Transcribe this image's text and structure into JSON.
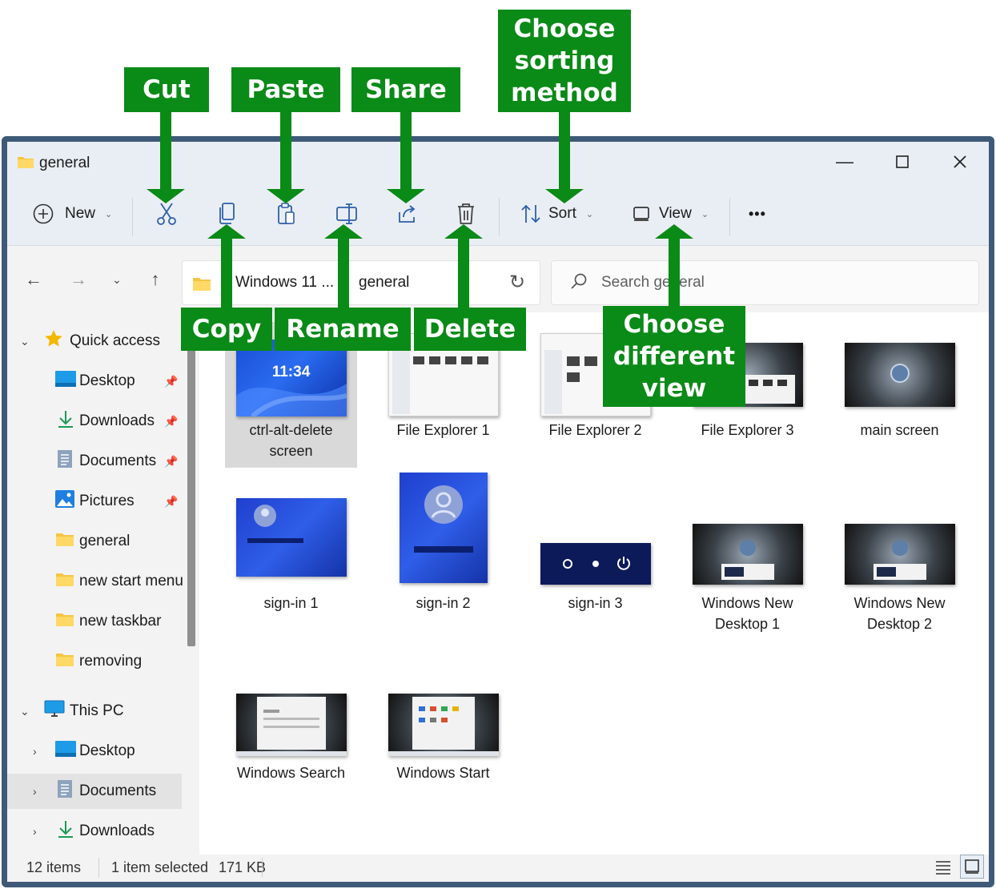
{
  "window": {
    "title": "general",
    "controls": {
      "minimize": "—",
      "maximize": "☐",
      "close": "✕"
    }
  },
  "toolbar": {
    "new_label": "New",
    "sort_label": "Sort",
    "view_label": "View",
    "more_label": "•••",
    "icons": [
      "cut-icon",
      "copy-icon",
      "paste-icon",
      "rename-icon",
      "share-icon",
      "delete-icon"
    ]
  },
  "address": {
    "segment1": "Windows 11 ...",
    "segment2": "general",
    "search_placeholder": "Search general"
  },
  "sidebar": {
    "quick_access": "Quick access",
    "items": [
      {
        "label": "Desktop",
        "pinned": true
      },
      {
        "label": "Downloads",
        "pinned": true
      },
      {
        "label": "Documents",
        "pinned": true
      },
      {
        "label": "Pictures",
        "pinned": true
      },
      {
        "label": "general",
        "pinned": false
      },
      {
        "label": "new start menu",
        "pinned": false
      },
      {
        "label": "new taskbar",
        "pinned": false
      },
      {
        "label": "removing",
        "pinned": false
      }
    ],
    "this_pc": "This PC",
    "pc_items": [
      {
        "label": "Desktop"
      },
      {
        "label": "Documents",
        "selected": true
      },
      {
        "label": "Downloads"
      }
    ]
  },
  "files": [
    {
      "line1": "ctrl-alt-delete",
      "line2": "screen",
      "thumb_time": "11:34",
      "selected": true
    },
    {
      "line1": "File Explorer 1",
      "line2": ""
    },
    {
      "line1": "File Explorer 2",
      "line2": ""
    },
    {
      "line1": "File Explorer 3",
      "line2": ""
    },
    {
      "line1": "main screen",
      "line2": ""
    },
    {
      "line1": "sign-in 1",
      "line2": ""
    },
    {
      "line1": "sign-in 2",
      "line2": ""
    },
    {
      "line1": "sign-in 3",
      "line2": ""
    },
    {
      "line1": "Windows New",
      "line2": "Desktop 1"
    },
    {
      "line1": "Windows New",
      "line2": "Desktop 2"
    },
    {
      "line1": "Windows Search",
      "line2": ""
    },
    {
      "line1": "Windows Start",
      "line2": ""
    }
  ],
  "status": {
    "items": "12 items",
    "selection": "1 item selected",
    "size": "171 KB"
  },
  "annotations": {
    "cut": "Cut",
    "paste": "Paste",
    "share": "Share",
    "sort_line1": "Choose",
    "sort_line2": "sorting",
    "sort_line3": "method",
    "copy": "Copy",
    "rename": "Rename",
    "delete": "Delete",
    "view_line1": "Choose",
    "view_line2": "different",
    "view_line3": "view"
  },
  "colors": {
    "annotation_green": "#0a8a17",
    "window_border": "#3e5a78",
    "folder_yellow": "#f5c542"
  }
}
